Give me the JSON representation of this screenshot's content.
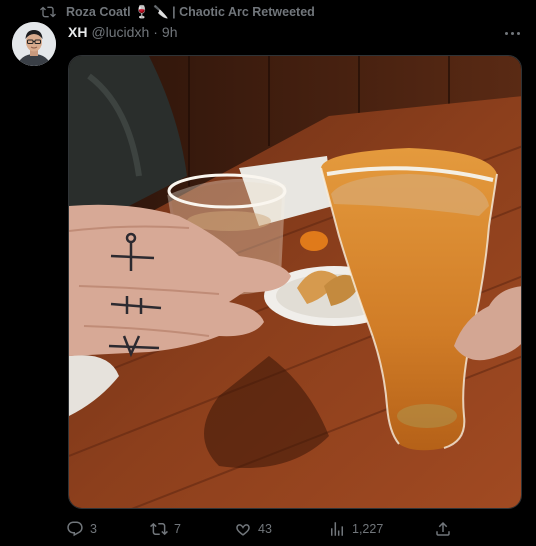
{
  "retweet": {
    "text": "Roza Coatl 🍷 🔪 | Chaotic Arc Retweeted"
  },
  "tweet": {
    "name": "XH",
    "handle": "@lucidxh",
    "separator": "·",
    "time": "9h"
  },
  "actions": {
    "replies": "3",
    "retweets": "7",
    "likes": "43",
    "views": "1,227"
  },
  "colors": {
    "background": "#000000",
    "muted": "#71767b",
    "text": "#e7e9ea"
  },
  "icons": [
    "retweet-icon",
    "more-icon",
    "reply-icon",
    "retweet-icon",
    "like-icon",
    "views-icon",
    "share-icon"
  ]
}
